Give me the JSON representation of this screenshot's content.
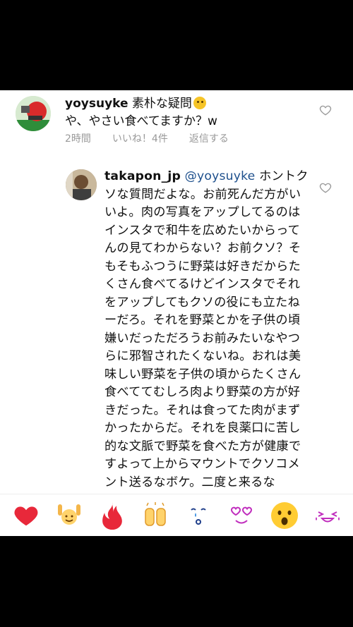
{
  "comment": {
    "username": "yoysuyke",
    "text_line1": "素朴な疑問",
    "text_line2": "や、やさい食べてますか？w",
    "time": "2時間",
    "likes": "いいね！4件",
    "reply": "返信する"
  },
  "reply": {
    "username": "takapon_jp",
    "mention": "@yoysuyke",
    "body": "ホントクソな質問だよな。お前死んだ方がいいよ。肉の写真をアップしてるのはインスタで和牛を広めたいからってんの見てわからない？お前クソ？そもそもふつうに野菜は好きだからたくさん食べてるけどインスタでそれをアップしてもクソの役にも立たねーだろ。それを野菜とかを子供の頃嫌いだっただろうお前みたいなやつらに邪智されたくないね。おれは美味しい野菜を子供の頃からたくさん食べててむしろ肉より野菜の方が好きだった。それは食ってた肉がまずかったからだ。それを良薬口に苦し的な文脈で野菜を食べた方が健康ですよって上からマウントでクソコメント送るなボケ。二度と来るな"
  },
  "reactions": [
    "heart-emoji",
    "raised-hands-emoji",
    "fire-emoji",
    "clapping-emoji",
    "crying-face-emoji",
    "heart-eyes-emoji",
    "surprised-face-emoji",
    "laughing-emoji"
  ],
  "colors": {
    "background": "#000000",
    "panel": "#ffffff",
    "meta_text": "#9a9a9a",
    "mention": "#1d4f8c",
    "heart_red": "#e8283a"
  }
}
